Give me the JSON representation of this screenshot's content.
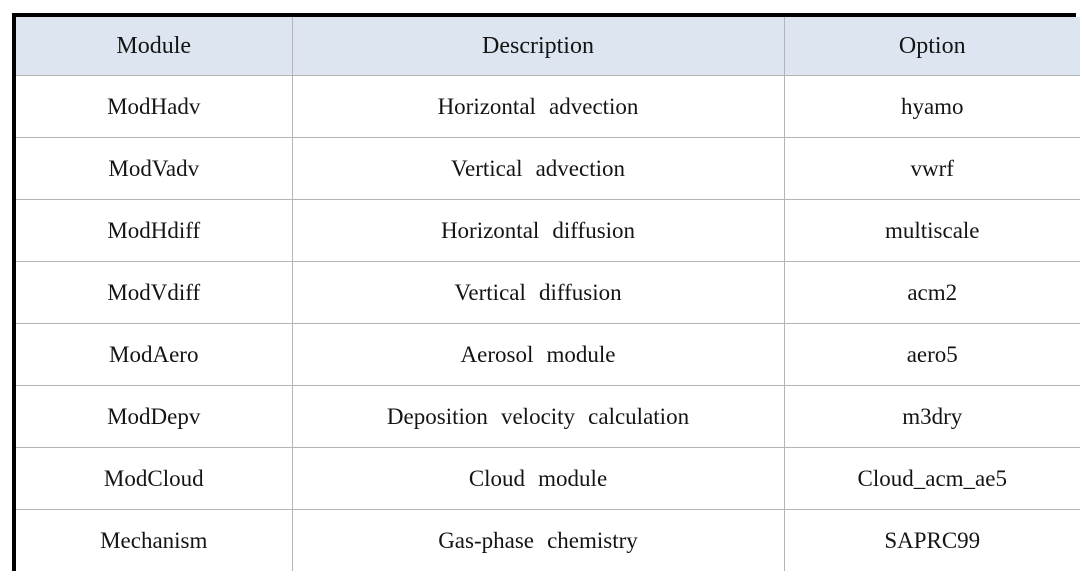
{
  "table": {
    "columns": [
      {
        "key": "module",
        "label": "Module"
      },
      {
        "key": "description",
        "label": "Description"
      },
      {
        "key": "option",
        "label": "Option"
      }
    ],
    "rows": [
      {
        "module": "ModHadv",
        "description": "Horizontal advection",
        "option": "hyamo"
      },
      {
        "module": "ModVadv",
        "description": "Vertical advection",
        "option": "vwrf"
      },
      {
        "module": "ModHdiff",
        "description": "Horizontal diffusion",
        "option": "multiscale"
      },
      {
        "module": "ModVdiff",
        "description": "Vertical diffusion",
        "option": "acm2"
      },
      {
        "module": "ModAero",
        "description": "Aerosol module",
        "option": "aero5"
      },
      {
        "module": "ModDepv",
        "description": "Deposition velocity calculation",
        "option": "m3dry"
      },
      {
        "module": "ModCloud",
        "description": "Cloud module",
        "option": "Cloud_acm_ae5"
      },
      {
        "module": "Mechanism",
        "description": "Gas-phase chemistry",
        "option": "SAPRC99"
      }
    ]
  },
  "style": {
    "header_background": "#dde6f0",
    "body_background": "#ffffff",
    "grid_line_color": "#b4b4b4",
    "outer_border_color": "#000000",
    "text_color": "#141414"
  }
}
